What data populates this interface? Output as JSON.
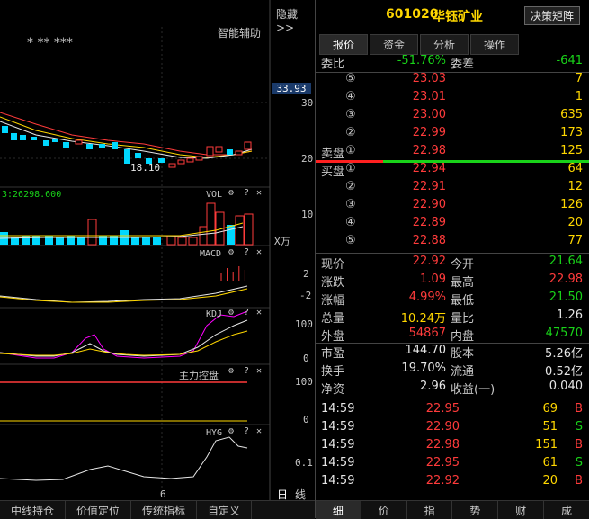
{
  "toolbar": {
    "hide_label": "隐藏>>",
    "smart_label": "智能辅助"
  },
  "chart": {
    "stars": "*  **  ***",
    "price_marker": "33.93",
    "price_axis": [
      "30",
      "20"
    ],
    "low_label": "18.10",
    "vol_prefix": "3:26298.600",
    "vol_title": "VOL",
    "vol_axis": "10",
    "vol_unit": "X万",
    "macd_title": "MACD",
    "macd_axis": [
      "2",
      "-2"
    ],
    "kdj_title": "KDJ",
    "kdj_axis": [
      "100",
      "0"
    ],
    "zl_title": "主力控盘",
    "zl_axis": [
      "100",
      "0"
    ],
    "hyg_title": "HYG",
    "hyg_axis": "0.1",
    "x_label": "6",
    "day_btn": "日",
    "line_btn": "线",
    "gear": "⚙",
    "help": "?",
    "close": "✕"
  },
  "bottom_tabs": [
    "中线持仓",
    "价值定位",
    "传统指标",
    "自定义"
  ],
  "stock": {
    "code": "601020",
    "name": "华钰矿业",
    "matrix_btn": "决策矩阵"
  },
  "tabs": [
    "报价",
    "资金",
    "分析",
    "操作"
  ],
  "weibi": {
    "l1": "委比",
    "v1": "-51.76%",
    "l2": "委差",
    "v2": "-641"
  },
  "sell_label": "卖盘",
  "buy_label": "买盘",
  "asks": [
    {
      "lvl": "5",
      "price": "23.03",
      "vol": "7"
    },
    {
      "lvl": "4",
      "price": "23.01",
      "vol": "1"
    },
    {
      "lvl": "3",
      "price": "23.00",
      "vol": "635"
    },
    {
      "lvl": "2",
      "price": "22.99",
      "vol": "173"
    },
    {
      "lvl": "1",
      "price": "22.98",
      "vol": "125"
    }
  ],
  "bids": [
    {
      "lvl": "1",
      "price": "22.94",
      "vol": "64"
    },
    {
      "lvl": "2",
      "price": "22.91",
      "vol": "12"
    },
    {
      "lvl": "3",
      "price": "22.90",
      "vol": "126"
    },
    {
      "lvl": "4",
      "price": "22.89",
      "vol": "20"
    },
    {
      "lvl": "5",
      "price": "22.88",
      "vol": "77"
    }
  ],
  "quote": [
    {
      "l1": "现价",
      "v1": "22.92",
      "c1": "red",
      "l2": "今开",
      "v2": "21.64",
      "c2": "grn"
    },
    {
      "l1": "涨跌",
      "v1": "1.09",
      "c1": "red",
      "l2": "最高",
      "v2": "22.98",
      "c2": "red"
    },
    {
      "l1": "涨幅",
      "v1": "4.99%",
      "c1": "red",
      "l2": "最低",
      "v2": "21.50",
      "c2": "grn"
    },
    {
      "l1": "总量",
      "v1": "10.24万",
      "c1": "yel",
      "l2": "量比",
      "v2": "1.26",
      "c2": "wht"
    },
    {
      "l1": "外盘",
      "v1": "54867",
      "c1": "red",
      "l2": "内盘",
      "v2": "47570",
      "c2": "grn"
    }
  ],
  "fund": [
    {
      "l1": "市盈",
      "v1": "144.70",
      "l2": "股本",
      "v2": "5.26亿"
    },
    {
      "l1": "换手",
      "v1": "19.70%",
      "l2": "流通",
      "v2": "0.52亿"
    },
    {
      "l1": "净资",
      "v1": "2.96",
      "l2": "收益(一)",
      "v2": "0.040"
    }
  ],
  "trades": [
    {
      "time": "14:59",
      "price": "22.95",
      "vol": "69",
      "side": "B",
      "c": "red"
    },
    {
      "time": "14:59",
      "price": "22.90",
      "vol": "51",
      "side": "S",
      "c": "grn"
    },
    {
      "time": "14:59",
      "price": "22.98",
      "vol": "151",
      "side": "B",
      "c": "red"
    },
    {
      "time": "14:59",
      "price": "22.95",
      "vol": "61",
      "side": "S",
      "c": "grn"
    },
    {
      "time": "14:59",
      "price": "22.92",
      "vol": "20",
      "side": "B",
      "c": "red"
    }
  ],
  "right_btabs": [
    "细",
    "价",
    "指",
    "势",
    "财",
    "成"
  ],
  "colors": {
    "up": "#ff3b3b",
    "down": "#19d219",
    "bg": "#000000",
    "accent": "#ffd700",
    "cyan": "#00d8ff",
    "magenta": "#ff00ff"
  }
}
